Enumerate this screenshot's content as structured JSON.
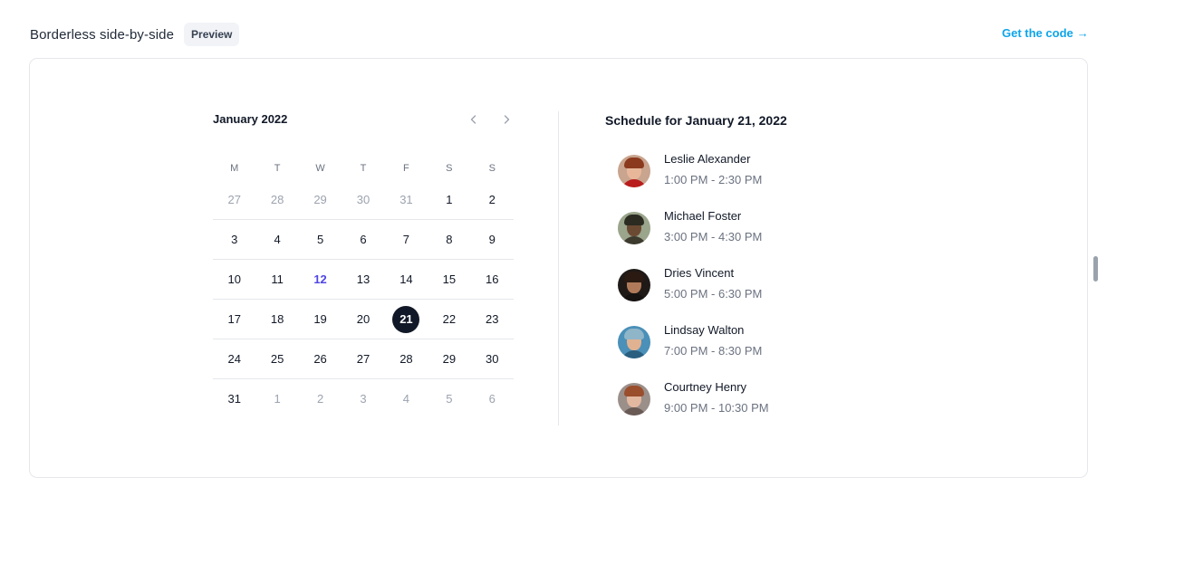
{
  "header": {
    "title": "Borderless side-by-side",
    "badge": "Preview",
    "get_code_label": "Get the code",
    "get_code_arrow": "→"
  },
  "calendar": {
    "month_label": "January 2022",
    "weekdays": [
      "M",
      "T",
      "W",
      "T",
      "F",
      "S",
      "S"
    ],
    "today": "12",
    "selected": "21",
    "weeks": [
      [
        {
          "d": "27",
          "muted": true
        },
        {
          "d": "28",
          "muted": true
        },
        {
          "d": "29",
          "muted": true
        },
        {
          "d": "30",
          "muted": true
        },
        {
          "d": "31",
          "muted": true
        },
        {
          "d": "1"
        },
        {
          "d": "2"
        }
      ],
      [
        {
          "d": "3"
        },
        {
          "d": "4"
        },
        {
          "d": "5"
        },
        {
          "d": "6"
        },
        {
          "d": "7"
        },
        {
          "d": "8"
        },
        {
          "d": "9"
        }
      ],
      [
        {
          "d": "10"
        },
        {
          "d": "11"
        },
        {
          "d": "12"
        },
        {
          "d": "13"
        },
        {
          "d": "14"
        },
        {
          "d": "15"
        },
        {
          "d": "16"
        }
      ],
      [
        {
          "d": "17"
        },
        {
          "d": "18"
        },
        {
          "d": "19"
        },
        {
          "d": "20"
        },
        {
          "d": "21"
        },
        {
          "d": "22"
        },
        {
          "d": "23"
        }
      ],
      [
        {
          "d": "24"
        },
        {
          "d": "25"
        },
        {
          "d": "26"
        },
        {
          "d": "27"
        },
        {
          "d": "28"
        },
        {
          "d": "29"
        },
        {
          "d": "30"
        }
      ],
      [
        {
          "d": "31"
        },
        {
          "d": "1",
          "muted": true
        },
        {
          "d": "2",
          "muted": true
        },
        {
          "d": "3",
          "muted": true
        },
        {
          "d": "4",
          "muted": true
        },
        {
          "d": "5",
          "muted": true
        },
        {
          "d": "6",
          "muted": true
        }
      ]
    ]
  },
  "schedule": {
    "title": "Schedule for January 21, 2022",
    "events": [
      {
        "name": "Leslie Alexander",
        "time": "1:00 PM - 2:30 PM",
        "colors": {
          "bg": "#c9a48e",
          "hair": "#8b3a1e",
          "face": "#e8b79a",
          "body": "#b91c1c"
        }
      },
      {
        "name": "Michael Foster",
        "time": "3:00 PM - 4:30 PM",
        "colors": {
          "bg": "#9aa58c",
          "hair": "#2b2b22",
          "face": "#6b4a33",
          "body": "#3d3a2e"
        }
      },
      {
        "name": "Dries Vincent",
        "time": "5:00 PM - 6:30 PM",
        "colors": {
          "bg": "#1f1a17",
          "hair": "#2a1a12",
          "face": "#b07a5a",
          "body": "#151211"
        }
      },
      {
        "name": "Lindsay Walton",
        "time": "7:00 PM - 8:30 PM",
        "colors": {
          "bg": "#4a90b8",
          "hair": "#8fb5c9",
          "face": "#e0b291",
          "body": "#2b5f80"
        }
      },
      {
        "name": "Courtney Henry",
        "time": "9:00 PM - 10:30 PM",
        "colors": {
          "bg": "#9b8f8a",
          "hair": "#9a4e2c",
          "face": "#e3b8a0",
          "body": "#6a5a55"
        }
      }
    ]
  },
  "colors": {
    "accent": "#0ea5e9",
    "today": "#4f46e5",
    "selected_bg": "#111827"
  }
}
